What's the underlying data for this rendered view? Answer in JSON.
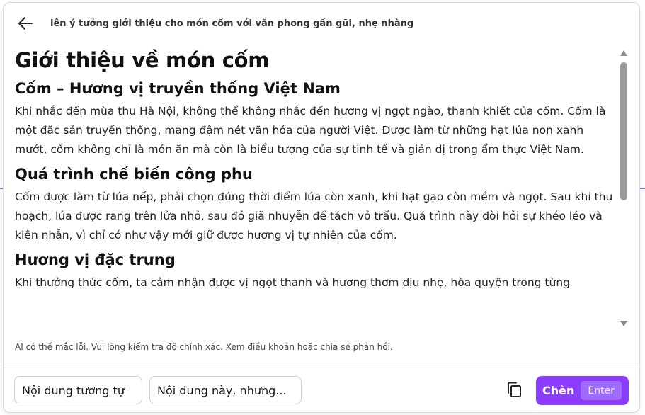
{
  "header": {
    "back_icon": "arrow-left-icon",
    "prompt": "lên ý tưởng giới thiệu cho món cốm với văn phong gần gũi, nhẹ nhàng"
  },
  "article": {
    "title": "Giới thiệu về món cốm",
    "sections": [
      {
        "heading": "Cốm – Hương vị truyền thống Việt Nam",
        "body": "Khi nhắc đến mùa thu Hà Nội, không thể không nhắc đến hương vị ngọt ngào, thanh khiết của cốm. Cốm là một đặc sản truyền thống, mang đậm nét văn hóa của người Việt. Được làm từ những hạt lúa non xanh mướt, cốm không chỉ là món ăn mà còn là biểu tượng của sự tinh tế và giản dị trong ẩm thực Việt Nam."
      },
      {
        "heading": "Quá trình chế biến công phu",
        "body": "Cốm được làm từ lúa nếp, phải chọn đúng thời điểm lúa còn xanh, khi hạt gạo còn mềm và ngọt. Sau khi thu hoạch, lúa được rang trên lửa nhỏ, sau đó giã nhuyễn để tách vỏ trấu. Quá trình này đòi hỏi sự khéo léo và kiên nhẫn, vì chỉ có như vậy mới giữ được hương vị tự nhiên của cốm."
      },
      {
        "heading": "Hương vị đặc trưng",
        "body": "Khi thưởng thức cốm, ta cảm nhận được vị ngọt thanh và hương thơm dịu nhẹ, hòa quyện trong từng"
      }
    ]
  },
  "disclaimer": {
    "prefix": "AI có thể mắc lỗi. Vui lòng kiểm tra độ chính xác. Xem ",
    "terms_link": "điều khoản",
    "middle": " hoặc ",
    "feedback_link": "chia sẻ phản hồi",
    "suffix": "."
  },
  "footer": {
    "similar_button": "Nội dung tương tự",
    "but_button": "Nội dung này, nhưng...",
    "copy_icon": "copy-icon",
    "insert_button": "Chèn",
    "insert_shortcut": "Enter"
  },
  "colors": {
    "accent": "#8b3dff",
    "accent_badge": "#a06bff",
    "scroll_thumb": "#9a9a9a"
  }
}
